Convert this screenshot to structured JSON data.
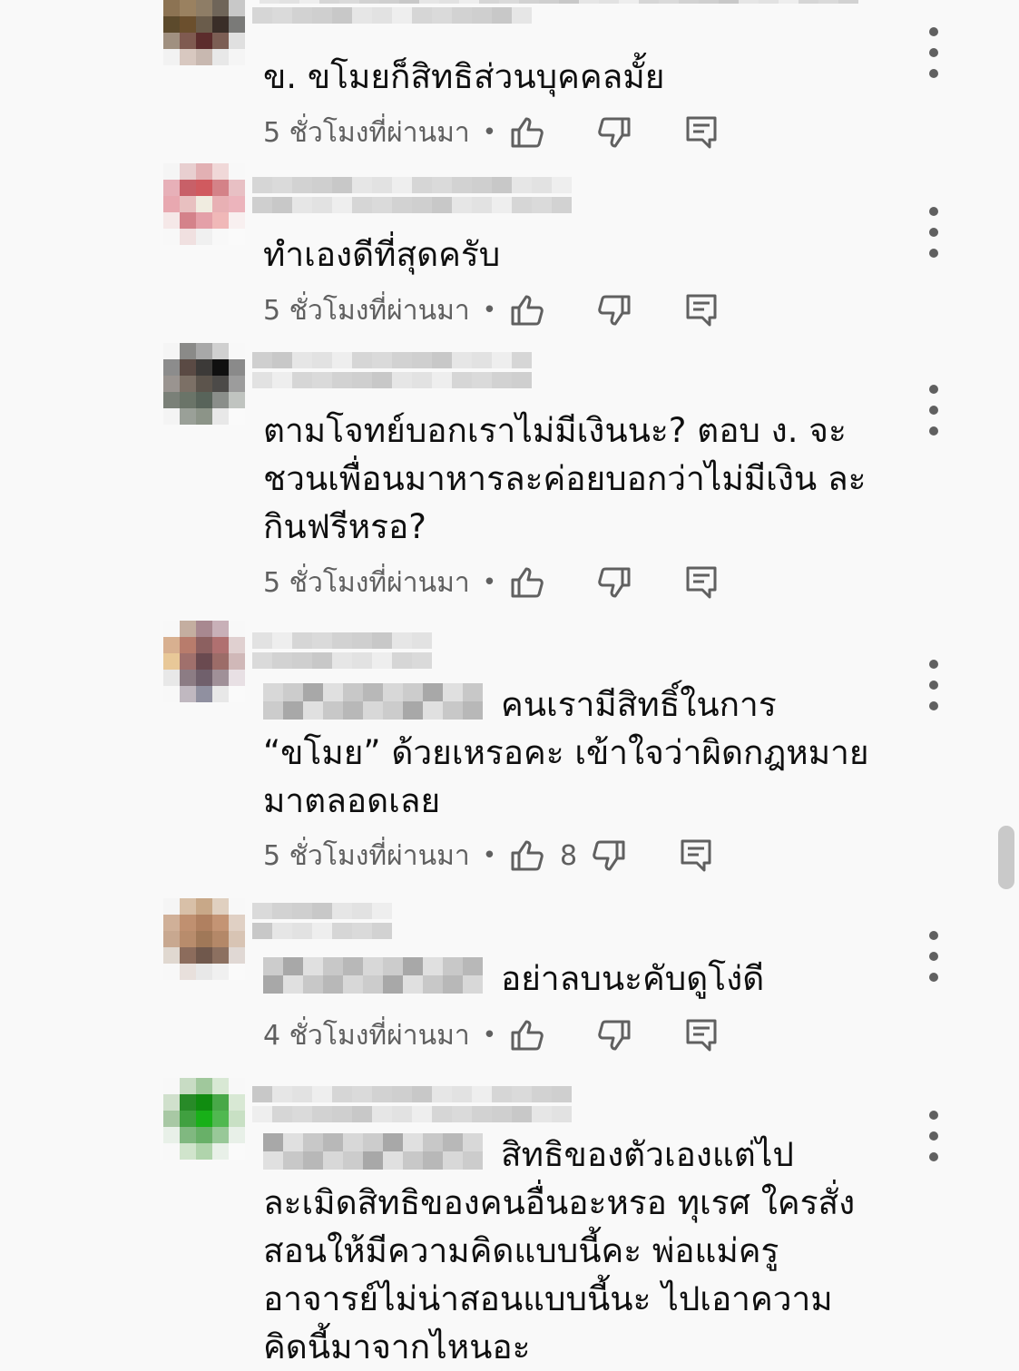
{
  "comments": [
    {
      "text": "ข. ขโมยก็สิทธิส่วนบุคคลมั้ย",
      "mention": false,
      "time": "5 ชั่วโมงที่ผ่านมา",
      "likes": "",
      "avatar_colors": [
        "#e9e9e9",
        "#b7a46c",
        "#c9b88a",
        "#b8b4a8",
        "#ececec",
        "#8c7353",
        "#9a8160",
        "#8e7d66",
        "#6f6559",
        "#c8c8c8",
        "#5c4a2c",
        "#6b4f2d",
        "#6a5c4b",
        "#3a2e28",
        "#7a7a78",
        "#a09080",
        "#7f5a50",
        "#5c2c2c",
        "#7c5e54",
        "#e0e0e0",
        "#f2f2f2",
        "#d8c8c0",
        "#c8b8b0",
        "#e8e8e8",
        "#f5f5f5"
      ]
    },
    {
      "text": "ทำเองดีที่สุดครับ",
      "mention": false,
      "time": "5 ชั่วโมงที่ผ่านมา",
      "likes": "",
      "avatar_colors": [
        "#f5f5f5",
        "#e8cfd0",
        "#e2b0b3",
        "#f0d8d8",
        "#f8f8f8",
        "#e7b0b8",
        "#c86068",
        "#d05a5f",
        "#d48288",
        "#e8c0c4",
        "#e8a8b0",
        "#e8c0c0",
        "#f0ece0",
        "#e8b0b4",
        "#ecb4bc",
        "#f5e8e8",
        "#d4828a",
        "#e4a0a8",
        "#f0b8b8",
        "#f8f0f0",
        "#f8f8f8",
        "#f0e0e0",
        "#f0f0f0",
        "#f8f8f8",
        "#fafafa"
      ]
    },
    {
      "text": "ตามโจทย์บอกเราไม่มีเงินนะ? ตอบ ง. จะชวนเพื่อนมาหารละค่อยบอกว่าไม่มีเงิน ละกินฟรีหรอ?",
      "mention": false,
      "time": "5 ชั่วโมงที่ผ่านมา",
      "likes": "",
      "avatar_colors": [
        "#f5f5f5",
        "#8a8a88",
        "#a8a8a8",
        "#d0d0d0",
        "#f8f8f8",
        "#8c8c8c",
        "#5a4a44",
        "#3c3a38",
        "#101010",
        "#8a8a8a",
        "#9a9490",
        "#7c7066",
        "#5c544c",
        "#4c4a48",
        "#9c9c9c",
        "#7a8078",
        "#6a7468",
        "#58645a",
        "#8a8e8a",
        "#c0c4c0",
        "#f4f4f4",
        "#9aa098",
        "#8c9488",
        "#e8e8e8",
        "#fafafa"
      ]
    },
    {
      "text": "คนเรามีสิทธิ์ในการ “ขโมย” ด้วยเหรอคะ เข้าใจว่าผิดกฎหมายมาตลอดเลย",
      "mention": true,
      "time": "5 ชั่วโมงที่ผ่านมา",
      "likes": "8",
      "avatar_colors": [
        "#f8f8f8",
        "#c4aea0",
        "#a88890",
        "#c8b0b8",
        "#f8f8f8",
        "#d8b090",
        "#b87c6c",
        "#8c6060",
        "#b07070",
        "#e0d0d0",
        "#e8c898",
        "#a0706c",
        "#6a4a50",
        "#9c6c68",
        "#d0b8b8",
        "#e8e8e8",
        "#8c7c84",
        "#70606c",
        "#a09098",
        "#e8e0e4",
        "#f8f8f8",
        "#c0b8c0",
        "#9090a0",
        "#e8e8e8",
        "#fafafa"
      ]
    },
    {
      "text": "อย่าลบนะคับดูโง่ดี",
      "mention": true,
      "time": "4 ชั่วโมงที่ผ่านมา",
      "likes": "",
      "avatar_colors": [
        "#f5f5f5",
        "#d8c0a8",
        "#c8a888",
        "#e0d0c0",
        "#f8f8f8",
        "#d0b098",
        "#c09070",
        "#b08060",
        "#c49474",
        "#e0d0c4",
        "#c8a890",
        "#b88c6c",
        "#a07858",
        "#b48868",
        "#d8c4b4",
        "#e0d8d0",
        "#8c6c5c",
        "#70584c",
        "#8c7060",
        "#e0d8d4",
        "#f8f8f8",
        "#e8e0dc",
        "#e8e8e8",
        "#f0f0f0",
        "#fafafa"
      ]
    },
    {
      "text": "สิทธิของตัวเองแต่ไปละเมิดสิทธิของคนอื่นอะหรอ ทุเรศ ใครสั่งสอนให้มีความคิดแบบนี้คะ พ่อแม่ครูอาจารย์ไม่น่าสอนแบบนี้นะ ไปเอาความคิดนี้มาจากไหนอะ",
      "mention": true,
      "time": "",
      "likes": "",
      "avatar_colors": [
        "#f8f8f8",
        "#c8dcc4",
        "#a0c89c",
        "#d8e8d4",
        "#f8f8f8",
        "#d0e0cc",
        "#288a28",
        "#108c10",
        "#48a848",
        "#d8e8d4",
        "#a8c8a4",
        "#40a040",
        "#18b018",
        "#50b850",
        "#c8e0c4",
        "#e8f0e8",
        "#80b880",
        "#68b068",
        "#98c898",
        "#e8f0e8",
        "#f8f8f8",
        "#d0e4cc",
        "#b0d4ac",
        "#e8f0e8",
        "#fafafa"
      ]
    }
  ],
  "blur_colors": [
    "#e6e6e6",
    "#d6d6d6",
    "#cfcfcf",
    "#e2e2e2",
    "#dadada",
    "#c8c8c8",
    "#eeeeee",
    "#d2d2d2"
  ],
  "accent_gray": "#606060",
  "icons": {
    "like": "thumbs-up-icon",
    "dislike": "thumbs-down-icon",
    "reply": "reply-icon",
    "more": "more-vertical-icon"
  }
}
